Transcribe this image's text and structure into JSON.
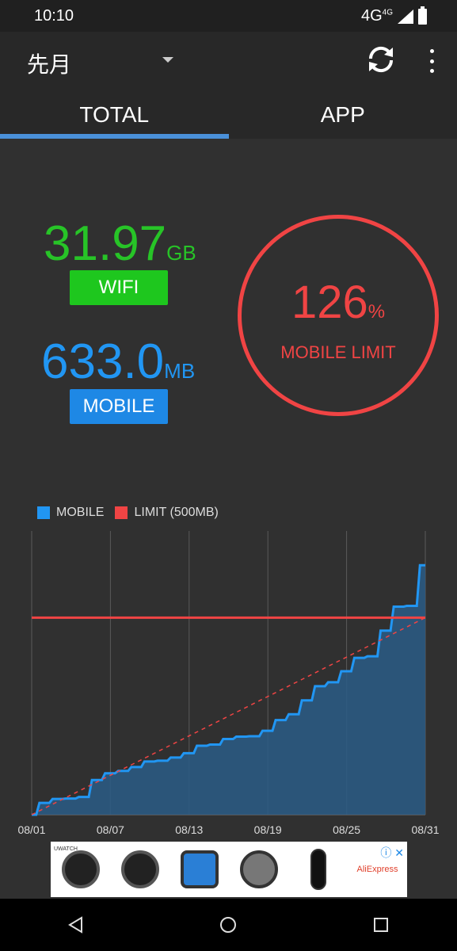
{
  "status_bar": {
    "time": "10:10",
    "network": "4G",
    "network_sup": "4G"
  },
  "toolbar": {
    "period": "先月"
  },
  "tabs": [
    {
      "label": "TOTAL",
      "active": true
    },
    {
      "label": "APP",
      "active": false
    }
  ],
  "summary": {
    "wifi_value": "31.97",
    "wifi_unit": "GB",
    "wifi_label": "WIFI",
    "mobile_value": "633.0",
    "mobile_unit": "MB",
    "mobile_label": "MOBILE",
    "limit_percent": "126",
    "limit_percent_unit": "%",
    "limit_label": "MOBILE LIMIT"
  },
  "colors": {
    "wifi": "#27c427",
    "mobile": "#2196f3",
    "limit": "#f04444"
  },
  "chart_data": {
    "type": "area",
    "legend": [
      {
        "name": "MOBILE",
        "color": "#2196f3"
      },
      {
        "name": "LIMIT (500MB)",
        "color": "#f04444"
      }
    ],
    "x_tick_labels": [
      "08/01",
      "08/07",
      "08/13",
      "08/19",
      "08/25",
      "08/31"
    ],
    "x": [
      "08/01",
      "08/02",
      "08/03",
      "08/04",
      "08/05",
      "08/06",
      "08/07",
      "08/08",
      "08/09",
      "08/10",
      "08/11",
      "08/12",
      "08/13",
      "08/14",
      "08/15",
      "08/16",
      "08/17",
      "08/18",
      "08/19",
      "08/20",
      "08/21",
      "08/22",
      "08/23",
      "08/24",
      "08/25",
      "08/26",
      "08/27",
      "08/28",
      "08/29",
      "08/30",
      "08/31"
    ],
    "series": [
      {
        "name": "MOBILE",
        "values": [
          0,
          30,
          40,
          41,
          45,
          88,
          105,
          111,
          121,
          135,
          137,
          145,
          156,
          175,
          178,
          192,
          198,
          199,
          213,
          240,
          255,
          290,
          326,
          336,
          364,
          398,
          402,
          467,
          528,
          530,
          633
        ]
      },
      {
        "name": "LIMIT (500MB)",
        "values": [
          500,
          500,
          500,
          500,
          500,
          500,
          500,
          500,
          500,
          500,
          500,
          500,
          500,
          500,
          500,
          500,
          500,
          500,
          500,
          500,
          500,
          500,
          500,
          500,
          500,
          500,
          500,
          500,
          500,
          500,
          500
        ]
      }
    ],
    "ylim": [
      0,
      720
    ],
    "grid": true
  }
}
